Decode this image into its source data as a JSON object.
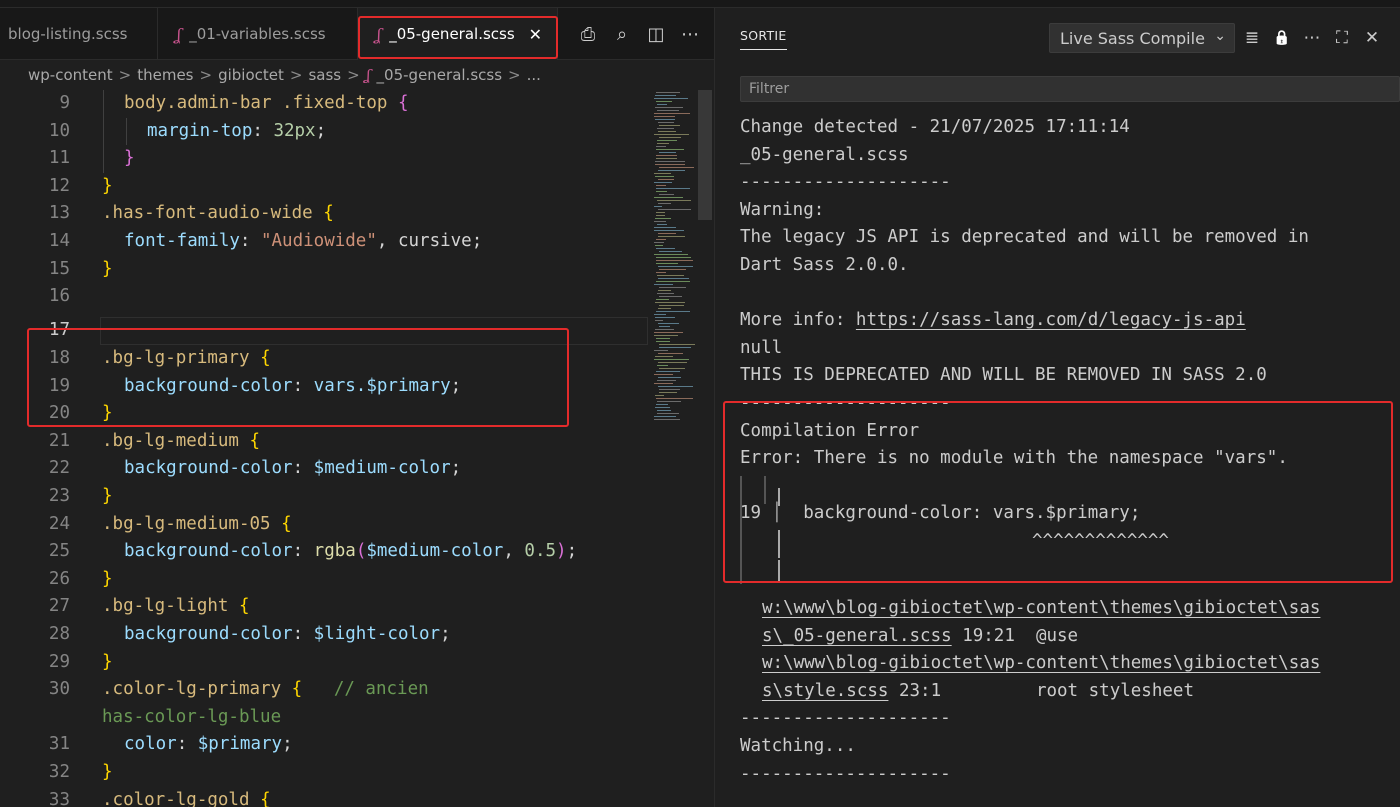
{
  "tabs": [
    {
      "label": "blog-listing.scss",
      "active": false
    },
    {
      "label": "_01-variables.scss",
      "active": false
    },
    {
      "label": "_05-general.scss",
      "active": true
    }
  ],
  "tab_close": "✕",
  "tab_actions": {
    "print_icon": "⎙",
    "search_icon": "⌕",
    "split_icon": "◫",
    "more_icon": "⋯"
  },
  "breadcrumb": [
    "wp-content",
    "themes",
    "gibioctet",
    "sass",
    "_05-general.scss",
    "..."
  ],
  "breadcrumb_sep": ">",
  "code_lines": [
    {
      "n": "9"
    },
    {
      "n": "10"
    },
    {
      "n": "11"
    },
    {
      "n": "12"
    },
    {
      "n": "13"
    },
    {
      "n": "14"
    },
    {
      "n": "15"
    },
    {
      "n": "16"
    },
    {
      "n": "17"
    },
    {
      "n": "18"
    },
    {
      "n": "19"
    },
    {
      "n": "20"
    },
    {
      "n": "21"
    },
    {
      "n": "22"
    },
    {
      "n": "23"
    },
    {
      "n": "24"
    },
    {
      "n": "25"
    },
    {
      "n": "26"
    },
    {
      "n": "27"
    },
    {
      "n": "28"
    },
    {
      "n": "29"
    },
    {
      "n": "30"
    },
    {
      "n": ""
    },
    {
      "n": "31"
    },
    {
      "n": "32"
    },
    {
      "n": "33"
    }
  ],
  "code": {
    "l9_sel": "body.admin-bar .fixed-top",
    "l10_prop": "margin-top",
    "l10_val": "32px",
    "l13_sel": ".has-font-audio-wide",
    "l14_prop": "font-family",
    "l14_str": "\"Audiowide\"",
    "l14_rest": "cursive",
    "l18_sel": ".bg-lg-primary",
    "l19_prop": "background-color",
    "l19_val": "vars.$primary",
    "l21_sel": ".bg-lg-medium",
    "l22_prop": "background-color",
    "l22_val": "$medium-color",
    "l24_sel": ".bg-lg-medium-05",
    "l25_prop": "background-color",
    "l25_fn": "rgba",
    "l25_var": "$medium-color",
    "l25_num": "0.5",
    "l27_sel": ".bg-lg-light",
    "l28_prop": "background-color",
    "l28_val": "$light-color",
    "l30_sel": ".color-lg-primary",
    "l30_com": "// ancien",
    "l30b_com": "has-color-lg-blue",
    "l31_prop": "color",
    "l31_val": "$primary",
    "l33_sel": ".color-lg-gold"
  },
  "output": {
    "title": "SORTIE",
    "channel": "Live Sass Compile",
    "chevron": "⌄",
    "actions": {
      "clear_icon": "≣",
      "lock_icon": "🔒",
      "more_icon": "⋯",
      "maximize_icon": "⛶",
      "close_icon": "✕"
    },
    "filter_placeholder": "Filtrer",
    "lines": [
      "Change detected - 21/07/2025 17:11:14",
      "_05-general.scss",
      "--------------------",
      "Warning:",
      "The legacy JS API is deprecated and will be removed in",
      "Dart Sass 2.0.0.",
      "",
      "More info: ",
      "null",
      "THIS IS DEPRECATED AND WILL BE REMOVED IN SASS 2.0",
      "--------------------",
      "Compilation Error",
      "Error: There is no module with the namespace \"vars\".",
      "",
      "19 ",
      "",
      ""
    ],
    "more_info_link": "https://sass-lang.com/d/legacy-js-api",
    "err_code": "  background-color: vars.$primary;",
    "err_carets": "^^^^^^^^^^^^^",
    "trace1_path": "w:\\www\\blog-gibioctet\\wp-content\\themes\\gibioctet\\sas",
    "trace1_file": "s\\_05-general.scss",
    "trace1_rest": " 19:21  @use",
    "trace2_path": "w:\\www\\blog-gibioctet\\wp-content\\themes\\gibioctet\\sas",
    "trace2_file": "s\\style.scss",
    "trace2_rest": " 23:1         root stylesheet",
    "sep": "--------------------",
    "watching": "Watching..."
  },
  "colors": {
    "highlight": "#e32b2b",
    "sass": "#c6538c"
  }
}
